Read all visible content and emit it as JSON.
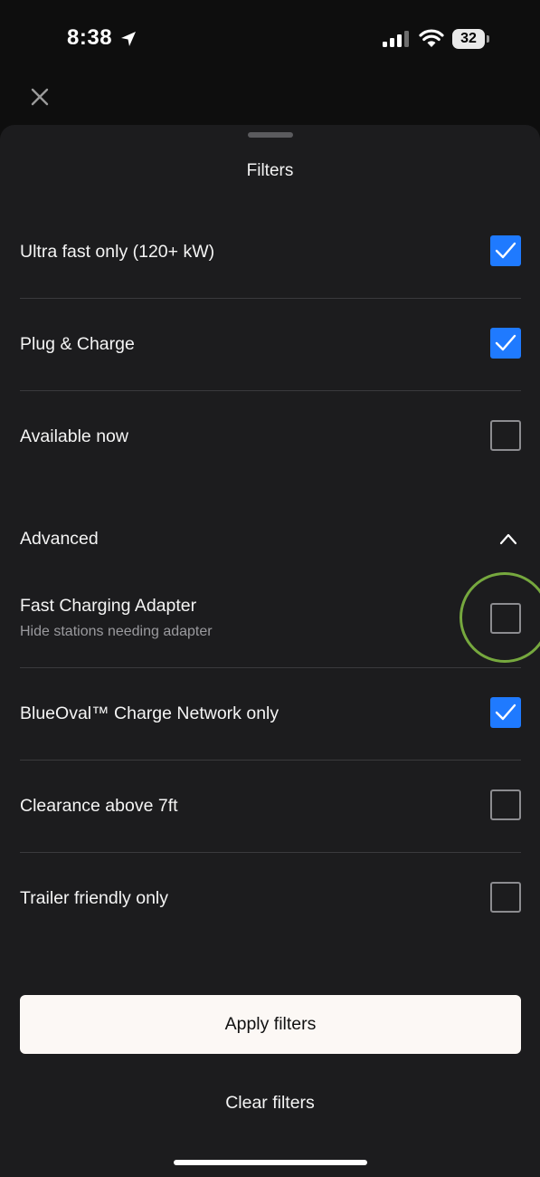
{
  "status_bar": {
    "time": "8:38",
    "battery": "32",
    "location_icon": "location-arrow-icon",
    "signal_icon": "cellular-signal-icon",
    "wifi_icon": "wifi-icon"
  },
  "header": {
    "close_icon": "close-icon",
    "title": "Filters"
  },
  "filters": [
    {
      "label": "Ultra fast only (120+ kW)",
      "checked": true
    },
    {
      "label": "Plug & Charge",
      "checked": true
    },
    {
      "label": "Available now",
      "checked": false
    }
  ],
  "advanced": {
    "label": "Advanced",
    "expanded": true,
    "icon": "chevron-up-icon",
    "items": [
      {
        "label": "Fast Charging Adapter",
        "sublabel": "Hide stations needing adapter",
        "checked": false,
        "highlighted": true
      },
      {
        "label": "BlueOval™ Charge Network only",
        "checked": true
      },
      {
        "label": "Clearance above 7ft",
        "checked": false
      },
      {
        "label": "Trailer friendly only",
        "checked": false
      }
    ]
  },
  "actions": {
    "apply_label": "Apply filters",
    "clear_label": "Clear filters"
  },
  "colors": {
    "accent": "#1f7aff",
    "sheet_background": "#1c1c1e",
    "highlight_ring": "#76a83e",
    "apply_button": "#fcf8f5"
  }
}
